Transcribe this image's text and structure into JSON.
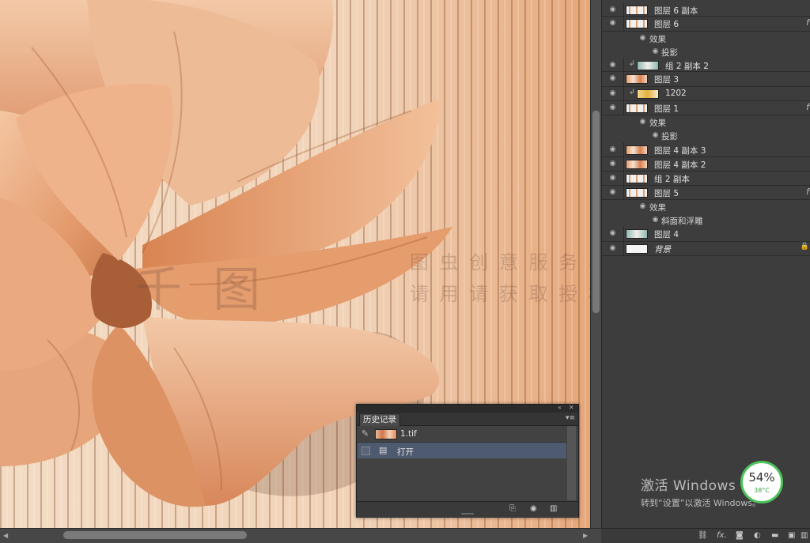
{
  "canvas": {
    "watermark_line1": "图 虫 创 意 服 务 与 协 作 平 台",
    "watermark_line2": "请 用 请 获 取 授 权",
    "watermark_logo": "千 图"
  },
  "layers": [
    {
      "name": "图层 6 副本",
      "thumb": "pattern"
    },
    {
      "name": "图层 6",
      "fx": "f",
      "thumb": "pattern"
    },
    {
      "name": "效果",
      "sub": true
    },
    {
      "name": "投影",
      "sub": true,
      "level": 2
    },
    {
      "name": "组 2 副本 2",
      "linked": true,
      "thumb": "teal"
    },
    {
      "name": "图层 3",
      "thumb": "orange"
    },
    {
      "name": "1202",
      "linked": true,
      "thumb": "yellow"
    },
    {
      "name": "图层 1",
      "fx": "f",
      "thumb": "pattern"
    },
    {
      "name": "效果",
      "sub": true
    },
    {
      "name": "投影",
      "sub": true,
      "level": 2
    },
    {
      "name": "图层 4 副本 3",
      "thumb": "orange"
    },
    {
      "name": "图层 4 副本 2",
      "thumb": "orange"
    },
    {
      "name": "组 2 副本",
      "thumb": "pattern"
    },
    {
      "name": "图层 5",
      "fx": "f",
      "thumb": "pattern"
    },
    {
      "name": "效果",
      "sub": true
    },
    {
      "name": "斜面和浮雕",
      "sub": true,
      "level": 2
    },
    {
      "name": "图层 4",
      "thumb": "teal"
    },
    {
      "name": "背景",
      "thumb": "white",
      "locked": true
    }
  ],
  "history": {
    "tab": "历史记录",
    "snapshot_name": "1.tif",
    "step": "打开"
  },
  "windows_activation": {
    "title": "激活 Windows",
    "subtitle": "转到“设置”以激活 Windows。"
  },
  "system_monitor": {
    "percent": "54%",
    "temp": "38°C"
  },
  "colors": {
    "panel_bg": "#3d3d3d",
    "selection": "#4e5a70",
    "gauge_ring": "#4cc45a"
  }
}
